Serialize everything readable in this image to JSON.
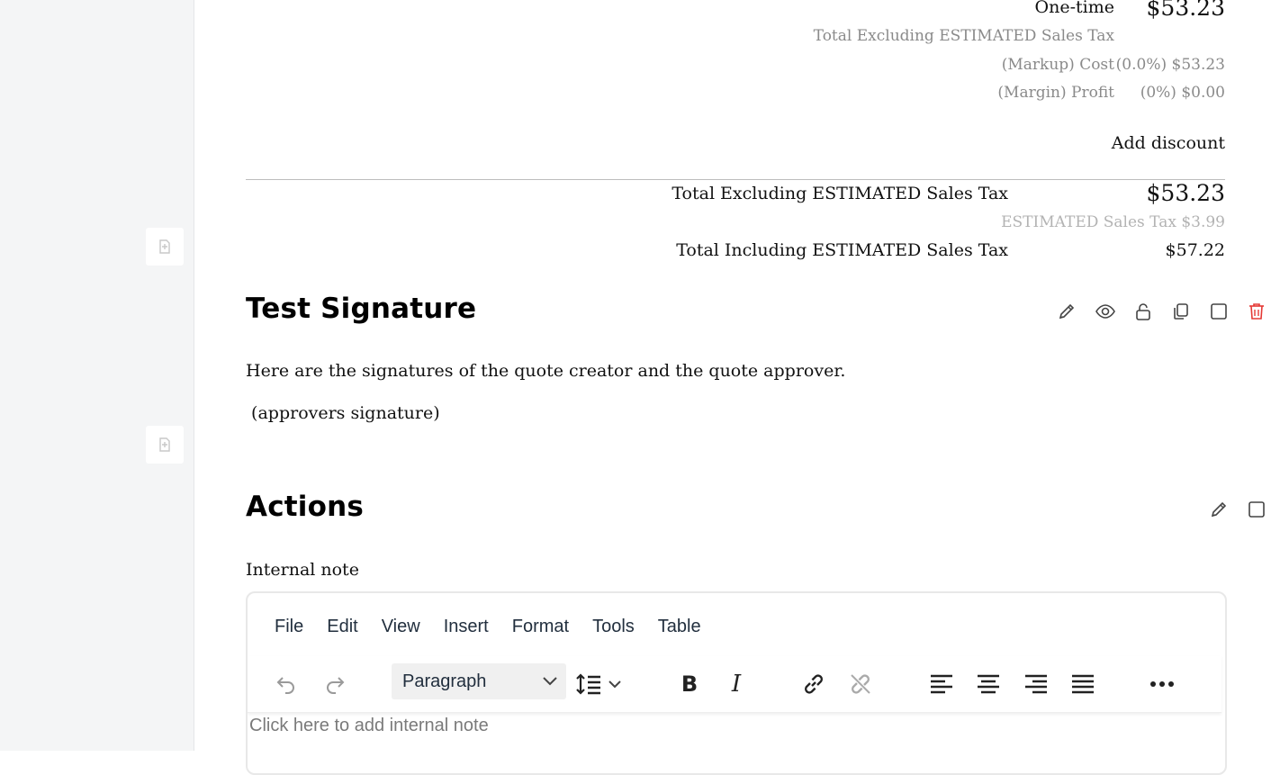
{
  "summary": {
    "onetime_label": "One-time",
    "onetime_value": "$53.23",
    "excl_tax_small": "Total Excluding ESTIMATED Sales Tax",
    "markup_label": "(Markup) Cost",
    "markup_value": "(0.0%) $53.23",
    "margin_label": "(Margin) Profit",
    "margin_value": "(0%) $0.00",
    "add_discount": "Add discount"
  },
  "totals": {
    "excl_label": "Total Excluding ESTIMATED Sales Tax",
    "excl_value": "$53.23",
    "tax_line": "ESTIMATED Sales Tax $3.99",
    "incl_label": "Total Including ESTIMATED Sales Tax",
    "incl_value": "$57.22"
  },
  "signature_section": {
    "title": "Test Signature",
    "body": "Here are the signatures of the quote creator and the quote approver.",
    "approver": " (approvers signature)",
    "icons": [
      "pencil-icon",
      "eye-icon",
      "unlock-icon",
      "copy-icon",
      "checkbox-icon",
      "trash-icon"
    ]
  },
  "actions_section": {
    "title": "Actions",
    "note_label": "Internal note"
  },
  "editor": {
    "menu": [
      "File",
      "Edit",
      "View",
      "Insert",
      "Format",
      "Tools",
      "Table"
    ],
    "block_format": "Paragraph",
    "placeholder": "Click here to add internal note"
  },
  "colors": {
    "danger": "#e53935",
    "sidebar_bg": "#f4f5f6",
    "text": "#111111",
    "muted": "#8a8a8a"
  }
}
